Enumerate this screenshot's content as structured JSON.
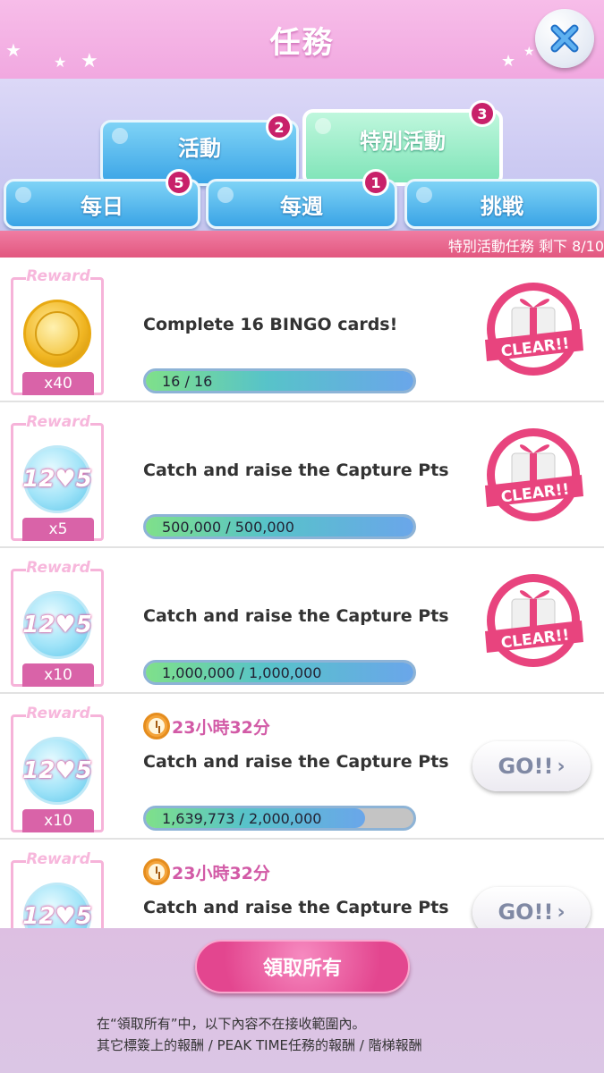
{
  "header": {
    "title": "任務"
  },
  "tabs": {
    "top": [
      {
        "label": "活動",
        "badge": "2"
      },
      {
        "label": "特別活動",
        "badge": "3",
        "selected": true
      }
    ],
    "bottom": [
      {
        "label": "每日",
        "badge": "5"
      },
      {
        "label": "每週",
        "badge": "1"
      },
      {
        "label": "挑戦",
        "badge": ""
      }
    ]
  },
  "status": {
    "text": "特別活動任務 剩下 8/10"
  },
  "missions": [
    {
      "reward_label": "Reward",
      "reward_icon": "coin-icon",
      "reward_qty": "x40",
      "title": "Complete 16 BINGO cards!",
      "timer": "",
      "progress_text": "16 / 16",
      "progress_fraction": 1.0,
      "state": "CLEAR!!"
    },
    {
      "reward_label": "Reward",
      "reward_icon": "badge-12-5-icon",
      "reward_badge_text": "12♥5",
      "reward_qty": "x5",
      "title": "Catch and raise the Capture Pts",
      "timer": "",
      "progress_text": "500,000 / 500,000",
      "progress_fraction": 1.0,
      "state": "CLEAR!!"
    },
    {
      "reward_label": "Reward",
      "reward_icon": "badge-12-5-icon",
      "reward_badge_text": "12♥5",
      "reward_qty": "x10",
      "title": "Catch and raise the Capture Pts",
      "timer": "",
      "progress_text": "1,000,000 / 1,000,000",
      "progress_fraction": 1.0,
      "state": "CLEAR!!"
    },
    {
      "reward_label": "Reward",
      "reward_icon": "badge-12-5-icon",
      "reward_badge_text": "12♥5",
      "reward_qty": "x10",
      "title": "Catch and raise the Capture Pts",
      "timer": "23小時32分",
      "progress_text": "1,639,773 / 2,000,000",
      "progress_fraction": 0.82,
      "state": "GO!!"
    },
    {
      "reward_label": "Reward",
      "reward_icon": "badge-12-5-icon",
      "reward_badge_text": "12♥5",
      "reward_qty": "",
      "title": "Catch and raise the Capture Pts",
      "timer": "23小時32分",
      "progress_text": "",
      "progress_fraction": null,
      "state": "GO!!"
    }
  ],
  "footer": {
    "claim_all": "領取所有",
    "note_line1": "在“領取所有”中，以下內容不在接收範圍內。",
    "note_line2": "其它標簽上的報酬 / PEAK TIME任務的報酬 / 階梯報酬"
  },
  "colors": {
    "header_pink": "#f1a8e0",
    "tab_blue": "#3aa4e6",
    "tab_green": "#7fe4b8",
    "badge_magenta": "#c8216a",
    "stamp_pink": "#e8447e"
  }
}
